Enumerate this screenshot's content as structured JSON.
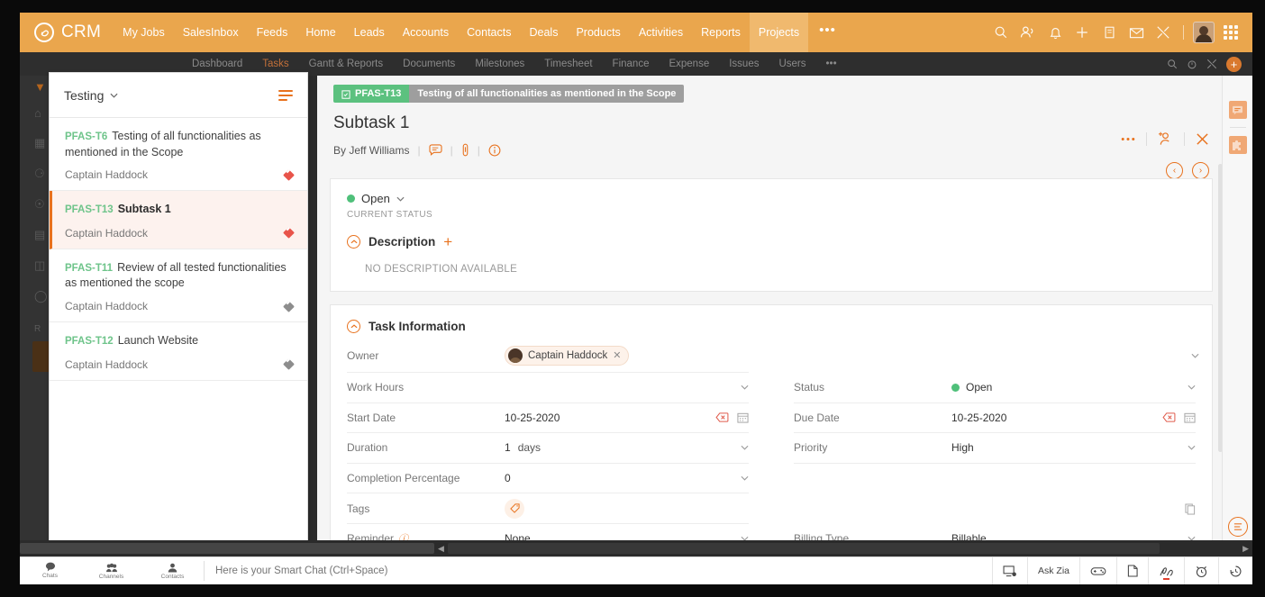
{
  "topbar": {
    "brand": "CRM",
    "brand_icon": "zoho-crm-logo-icon",
    "nav": [
      {
        "label": "My Jobs",
        "active": false
      },
      {
        "label": "SalesInbox",
        "active": false
      },
      {
        "label": "Feeds",
        "active": false
      },
      {
        "label": "Home",
        "active": false
      },
      {
        "label": "Leads",
        "active": false
      },
      {
        "label": "Accounts",
        "active": false
      },
      {
        "label": "Contacts",
        "active": false
      },
      {
        "label": "Deals",
        "active": false
      },
      {
        "label": "Products",
        "active": false
      },
      {
        "label": "Activities",
        "active": false
      },
      {
        "label": "Reports",
        "active": false
      },
      {
        "label": "Projects",
        "active": true
      }
    ],
    "more": "•••",
    "icons": [
      "search-icon",
      "contacts-icon",
      "bell-icon",
      "plus-icon",
      "notes-icon",
      "mail-icon",
      "tools-icon"
    ],
    "accent": "#eaa64d",
    "accent_active": "#f0b96e"
  },
  "subnav": {
    "items": [
      {
        "label": "Dashboard",
        "active": false
      },
      {
        "label": "Tasks",
        "active": true
      },
      {
        "label": "Gantt & Reports",
        "active": false
      },
      {
        "label": "Documents",
        "active": false
      },
      {
        "label": "Milestones",
        "active": false
      },
      {
        "label": "Timesheet",
        "active": false
      },
      {
        "label": "Finance",
        "active": false
      },
      {
        "label": "Expense",
        "active": false
      },
      {
        "label": "Issues",
        "active": false
      },
      {
        "label": "Users",
        "active": false
      }
    ],
    "more": "•••"
  },
  "tasklist": {
    "title": "Testing",
    "caret": "⌄",
    "items": [
      {
        "key": "PFAS-T6",
        "name": "Testing of all functionalities as mentioned in the Scope",
        "owner": "Captain Haddock",
        "priority": "high",
        "selected": false
      },
      {
        "key": "PFAS-T13",
        "name": "Subtask 1",
        "owner": "Captain Haddock",
        "priority": "high",
        "selected": true
      },
      {
        "key": "PFAS-T11",
        "name": "Review of all tested functionalities as mentioned the scope",
        "owner": "Captain Haddock",
        "priority": "medium",
        "selected": false
      },
      {
        "key": "PFAS-T12",
        "name": "Launch Website",
        "owner": "Captain Haddock",
        "priority": "medium",
        "selected": false
      }
    ]
  },
  "detail": {
    "breadcrumb": {
      "key": "PFAS-T13",
      "parent": "Testing of all functionalities as mentioned in the Scope"
    },
    "title": "Subtask 1",
    "byline": "By Jeff Williams",
    "byline_icons": [
      "comment-icon",
      "attachment-icon",
      "info-icon"
    ],
    "actions": [
      "more-options-icon",
      "assign-user-icon",
      "close-icon"
    ],
    "nav_prev": "‹",
    "nav_next": "›",
    "status": {
      "value": "Open",
      "label": "CURRENT STATUS",
      "color": "#4fc07a"
    },
    "description": {
      "title": "Description",
      "empty": "NO DESCRIPTION AVAILABLE",
      "add": "+"
    },
    "task_information": {
      "title": "Task Information",
      "left_rows": [
        {
          "label": "Owner",
          "value": "Captain Haddock",
          "type": "chip"
        },
        {
          "label": "Work Hours",
          "value": "",
          "type": "select"
        },
        {
          "label": "Start Date",
          "value": "10-25-2020",
          "type": "date"
        },
        {
          "label": "Duration",
          "value": "1",
          "unit": "days",
          "type": "select"
        },
        {
          "label": "Completion Percentage",
          "value": "0",
          "type": "select"
        },
        {
          "label": "Tags",
          "value": "",
          "type": "tag"
        },
        {
          "label": "Reminder",
          "required": true,
          "value": "None",
          "type": "select"
        }
      ],
      "right_rows": [
        {
          "label": "",
          "value": "",
          "type": "blank"
        },
        {
          "label": "Status",
          "value": "Open",
          "type": "status"
        },
        {
          "label": "Due Date",
          "value": "10-25-2020",
          "type": "date"
        },
        {
          "label": "Priority",
          "value": "High",
          "type": "select"
        },
        {
          "label": "",
          "value": "",
          "type": "blank"
        },
        {
          "label": "",
          "value": "",
          "type": "blank"
        },
        {
          "label": "Billing Type",
          "value": "Billable",
          "type": "select"
        }
      ]
    }
  },
  "right_rail": {
    "icons": [
      "chat-bubble-icon",
      "extensions-icon"
    ],
    "bottom_icon": "menu-list-icon"
  },
  "bottombar": {
    "tabs": [
      {
        "label": "Chats",
        "icon": "chat-icon",
        "active": true
      },
      {
        "label": "Channels",
        "icon": "channels-icon",
        "active": false
      },
      {
        "label": "Contacts",
        "icon": "contacts-icon",
        "active": false
      }
    ],
    "input_placeholder": "Here is your Smart Chat (Ctrl+Space)",
    "right_buttons": [
      {
        "label": "",
        "icon": "screen-share-icon"
      },
      {
        "label": "Ask Zia",
        "icon": ""
      },
      {
        "label": "",
        "icon": "game-controller-icon"
      },
      {
        "label": "",
        "icon": "notes-icon"
      },
      {
        "label": "",
        "icon": "draw-pen-icon",
        "badge": true
      },
      {
        "label": "",
        "icon": "alarm-clock-icon"
      },
      {
        "label": "",
        "icon": "history-icon"
      }
    ]
  }
}
